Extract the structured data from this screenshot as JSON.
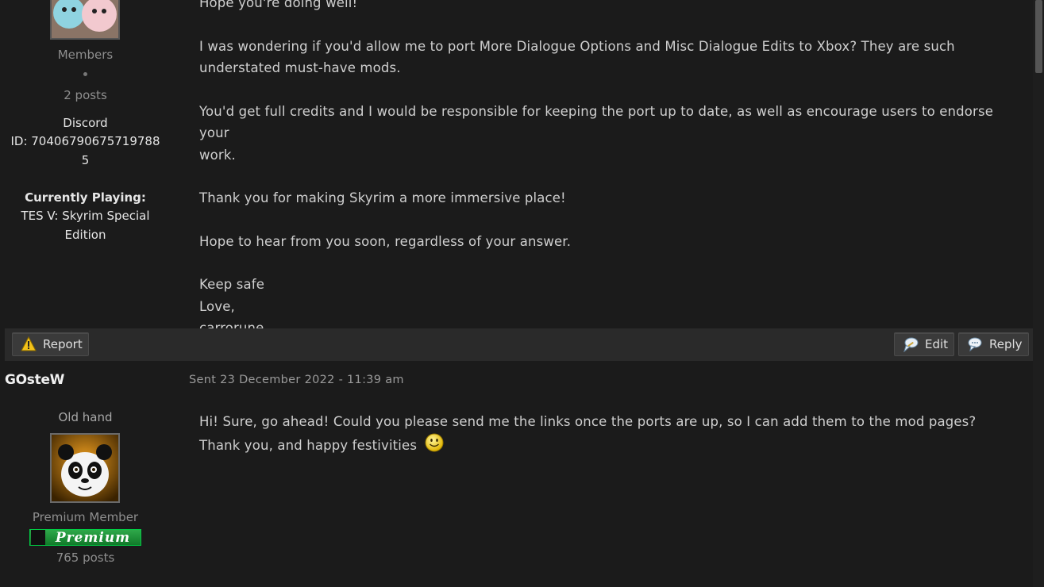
{
  "post1": {
    "group": "Members",
    "posts": "2 posts",
    "discord_line1": "Discord",
    "discord_line2": "ID: 70406790675719788",
    "discord_line3": "5",
    "playing_label": "Currently Playing:",
    "playing_line1": "TES V: Skyrim Special",
    "playing_line2": "Edition",
    "message": {
      "line1": "Hope you're doing well!",
      "line2": "I was wondering if you'd allow me to port More Dialogue Options and Misc Dialogue Edits to Xbox? They are such",
      "line3": "understated must-have mods.",
      "line4": "You'd get full credits and I would be responsible for keeping the port up to date, as well as encourage users to endorse your",
      "line5": "work.",
      "line6": "Thank you for making Skyrim a more immersive place!",
      "line7": "Hope to hear from you soon, regardless of your answer.",
      "line8": "Keep safe",
      "line9": "Love,",
      "line10": "carrorune"
    }
  },
  "actions": {
    "report": "Report",
    "edit": "Edit",
    "reply": "Reply"
  },
  "post2": {
    "author": "GOsteW",
    "sent": "Sent 23 December 2022 - 11:39 am",
    "rank": "Old hand",
    "group": "Premium Member",
    "badge": "Premium",
    "posts": "765 posts",
    "message": {
      "line1": "Hi! Sure, go ahead! Could you please send me the links once the ports are up, so I can add them to the mod pages?",
      "line2": "Thank you, and happy festivities"
    }
  },
  "icons": {
    "report": "warning-icon",
    "edit": "speech-bubble-edit-icon",
    "reply": "speech-bubble-reply-icon",
    "emoji": "smiley-icon"
  },
  "colors": {
    "background": "#1b1b1b",
    "bar": "#2a2a2a",
    "badge_green": "#1f8f3a"
  }
}
